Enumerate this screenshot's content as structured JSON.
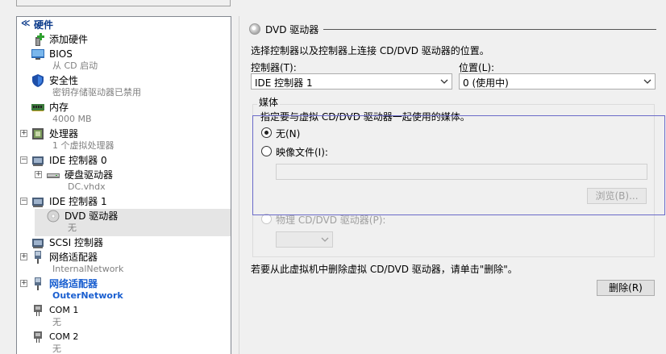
{
  "tree": {
    "header": "硬件",
    "items": [
      {
        "label": "添加硬件"
      },
      {
        "label": "BIOS",
        "sub": "从 CD 启动"
      },
      {
        "label": "安全性",
        "sub": "密钥存储驱动器已禁用"
      },
      {
        "label": "内存",
        "sub": "4000 MB"
      },
      {
        "label": "处理器",
        "sub": "1 个虚拟处理器"
      },
      {
        "label": "IDE 控制器 0"
      },
      {
        "label": "硬盘驱动器",
        "sub": "DC.vhdx"
      },
      {
        "label": "IDE 控制器 1"
      },
      {
        "label": "DVD 驱动器",
        "sub": "无"
      },
      {
        "label": "SCSI 控制器"
      },
      {
        "label": "网络适配器",
        "sub": "InternalNetwork"
      },
      {
        "label": "网络适配器",
        "sub": "OuterNetwork"
      },
      {
        "label": "COM 1",
        "sub": "无"
      },
      {
        "label": "COM 2",
        "sub": "无"
      }
    ],
    "expanders": {
      "collapse": "−",
      "expand": "+"
    }
  },
  "panel": {
    "title": "DVD 驱动器",
    "description": "选择控制器以及控制器上连接 CD/DVD 驱动器的位置。",
    "controller_label": "控制器(T):",
    "controller_value": "IDE 控制器 1",
    "location_label": "位置(L):",
    "location_value": "0 (使用中)",
    "media_group": "媒体",
    "media_desc": "指定要与虚拟 CD/DVD 驱动器一起使用的媒体。",
    "none_label": "无(N)",
    "image_label": "映像文件(I):",
    "image_path": "",
    "browse_label": "浏览(B)...",
    "physical_label": "物理 CD/DVD 驱动器(P):",
    "remove_hint": "若要从此虚拟机中删除虚拟 CD/DVD 驱动器，请单击\"删除\"。",
    "remove_label": "删除(R)"
  }
}
